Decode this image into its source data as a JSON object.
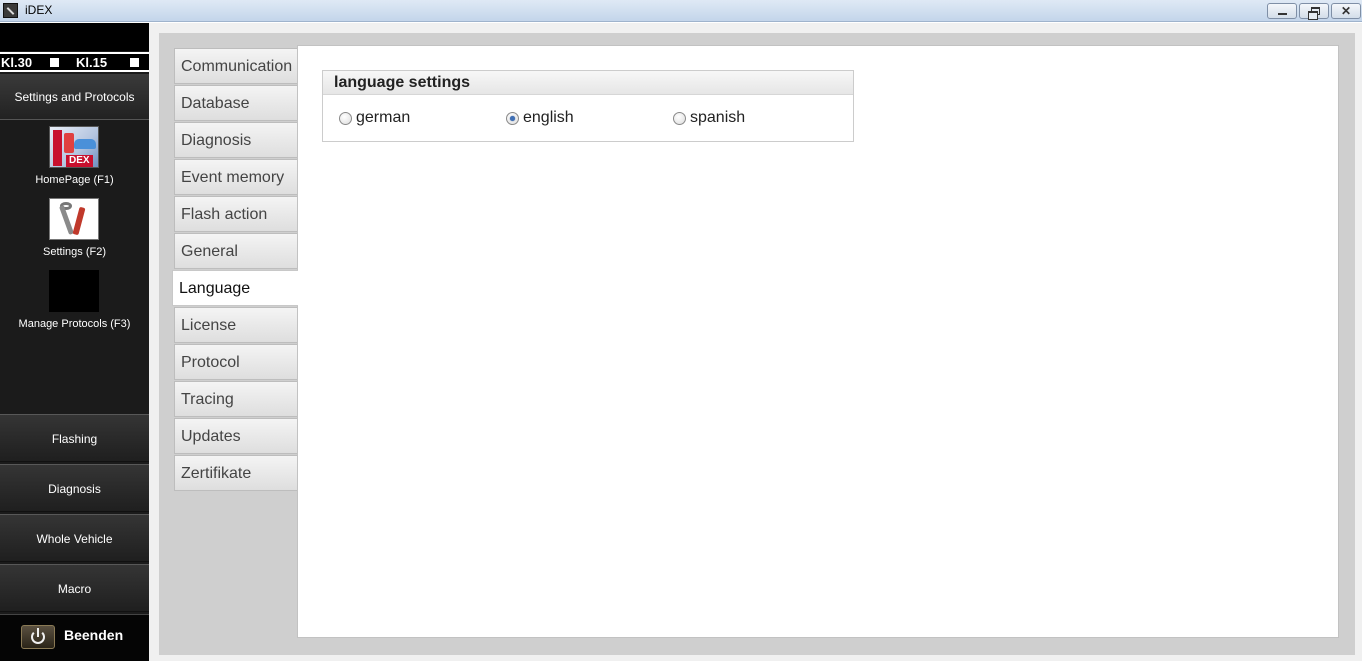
{
  "window": {
    "title": "iDEX",
    "controls": {
      "minimize": "minimize",
      "maximize": "restore",
      "close": "✕"
    }
  },
  "sidebar": {
    "status": {
      "kl30": "Kl.30",
      "kl15": "Kl.15"
    },
    "header_button": "Settings and Protocols",
    "tools": [
      {
        "label": "HomePage (F1)",
        "icon": "idex-logo-icon",
        "logo_text": "DEX"
      },
      {
        "label": "Settings (F2)",
        "icon": "tools-icon"
      },
      {
        "label": "Manage Protocols (F3)",
        "icon": "protocols-icon"
      }
    ],
    "nav": [
      "Flashing",
      "Diagnosis",
      "Whole Vehicle",
      "Macro"
    ],
    "exit_label": "Beenden"
  },
  "tabs": {
    "items": [
      "Communication",
      "Database",
      "Diagnosis",
      "Event memory",
      "Flash action",
      "General",
      "Language",
      "License",
      "Protocol",
      "Tracing",
      "Updates",
      "Zertifikate"
    ],
    "active": "Language"
  },
  "language_settings": {
    "title": "language settings",
    "options": [
      {
        "label": "german",
        "checked": false
      },
      {
        "label": "english",
        "checked": true
      },
      {
        "label": "spanish",
        "checked": false
      }
    ]
  },
  "colors": {
    "sidebar_bg": "#1b1b1b",
    "radio_dot": "#3f6fb5",
    "title_bar": "#c3d5ea"
  }
}
